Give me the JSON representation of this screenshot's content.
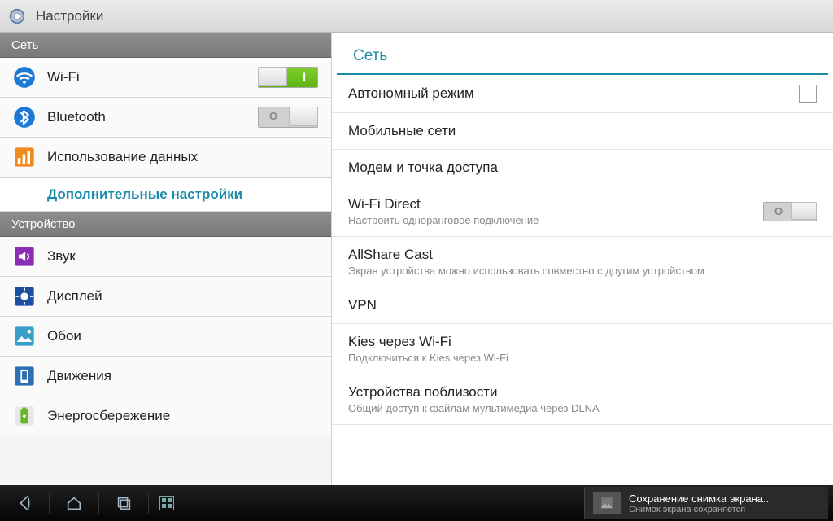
{
  "header": {
    "title": "Настройки"
  },
  "sidebar": {
    "sections": [
      {
        "title": "Сеть",
        "items": [
          {
            "label": "Wi-Fi",
            "icon": "wifi",
            "toggle": "on"
          },
          {
            "label": "Bluetooth",
            "icon": "bt",
            "toggle": "off"
          },
          {
            "label": "Использование данных",
            "icon": "data"
          },
          {
            "label": "Дополнительные настройки",
            "selected": true
          }
        ]
      },
      {
        "title": "Устройство",
        "items": [
          {
            "label": "Звук",
            "icon": "sound"
          },
          {
            "label": "Дисплей",
            "icon": "display"
          },
          {
            "label": "Обои",
            "icon": "wall"
          },
          {
            "label": "Движения",
            "icon": "motion"
          },
          {
            "label": "Энергосбережение",
            "icon": "battery"
          }
        ]
      }
    ]
  },
  "detail": {
    "header": "Сеть",
    "items": [
      {
        "title": "Автономный режим",
        "control": "checkbox"
      },
      {
        "title": "Мобильные сети"
      },
      {
        "title": "Модем и точка доступа"
      },
      {
        "title": "Wi-Fi Direct",
        "subtitle": "Настроить одноранговое подключение",
        "control": "toggle-off"
      },
      {
        "title": "AllShare Cast",
        "subtitle": "Экран устройства можно использовать совместно с другим устройством"
      },
      {
        "title": "VPN"
      },
      {
        "title": "Kies через Wi-Fi",
        "subtitle": "Подключиться к Kies через Wi-Fi"
      },
      {
        "title": "Устройства поблизости",
        "subtitle": "Общий доступ к файлам мультимедиа через DLNA"
      }
    ]
  },
  "notification": {
    "title": "Сохранение снимка экрана..",
    "subtitle": "Снимок экрана сохраняется"
  }
}
